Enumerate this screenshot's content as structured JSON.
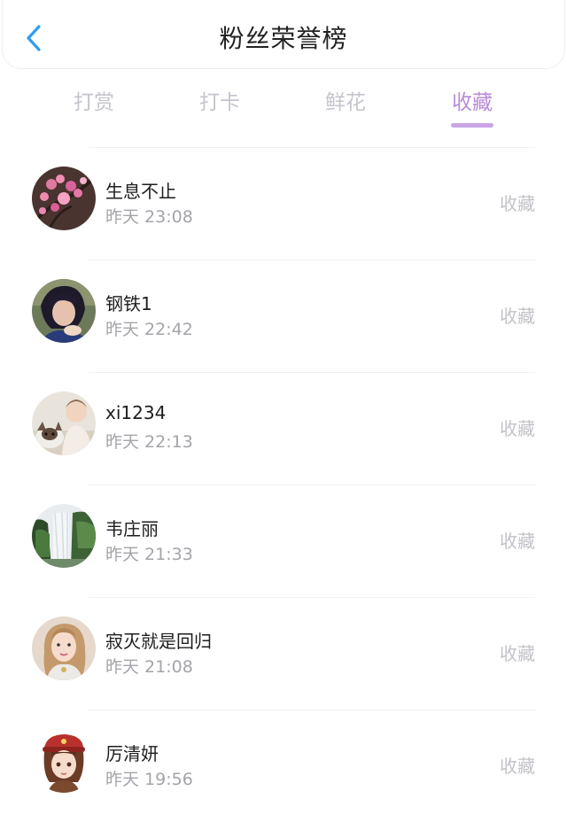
{
  "header": {
    "title": "粉丝荣誉榜",
    "back_icon": "chevron-left-icon",
    "back_color": "#2f9cf2"
  },
  "tabs": [
    {
      "label": "打赏",
      "active": false
    },
    {
      "label": "打卡",
      "active": false
    },
    {
      "label": "鲜花",
      "active": false
    },
    {
      "label": "收藏",
      "active": true
    }
  ],
  "colors": {
    "accent": "#b98ad6",
    "indicator": "#c9a5e6",
    "muted_text": "#a4a4aa",
    "inactive_tab": "#c4c4cc"
  },
  "fans": [
    {
      "name": "生息不止",
      "time": "昨天 23:08",
      "action": "收藏",
      "avatar": "plum-blossom-avatar"
    },
    {
      "name": "钢铁1",
      "time": "昨天 22:42",
      "action": "收藏",
      "avatar": "woman-portrait-avatar"
    },
    {
      "name": "xi1234",
      "time": "昨天 22:13",
      "action": "收藏",
      "avatar": "child-with-dog-avatar"
    },
    {
      "name": "韦庄丽",
      "time": "昨天 21:33",
      "action": "收藏",
      "avatar": "waterfall-avatar"
    },
    {
      "name": "寂灭就是回归",
      "time": "昨天 21:08",
      "action": "收藏",
      "avatar": "woman-selfie-avatar"
    },
    {
      "name": "厉清妍",
      "time": "昨天 19:56",
      "action": "收藏",
      "avatar": "anime-girl-avatar"
    }
  ]
}
